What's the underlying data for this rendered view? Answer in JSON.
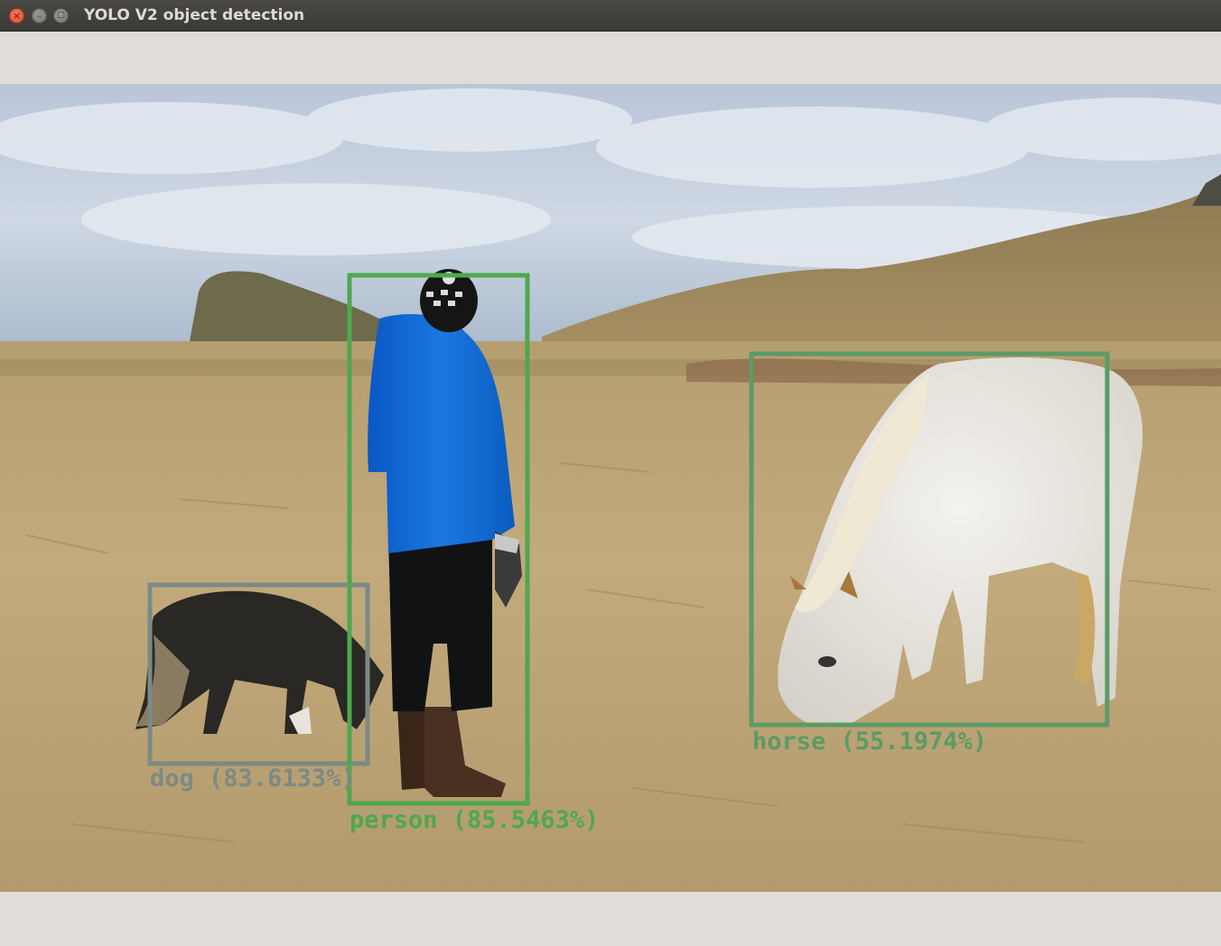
{
  "window": {
    "title": "YOLO V2 object detection",
    "controls": {
      "close": "×",
      "minimize": "–",
      "maximize": "□"
    }
  },
  "colors": {
    "person_box": "#4ea84e",
    "horse_box": "#5c9a66",
    "dog_box": "#7c8a84"
  },
  "detections": [
    {
      "label": "dog (83.6133%)"
    },
    {
      "label": "person (85.5463%)"
    },
    {
      "label": "horse (55.1974%)"
    }
  ]
}
